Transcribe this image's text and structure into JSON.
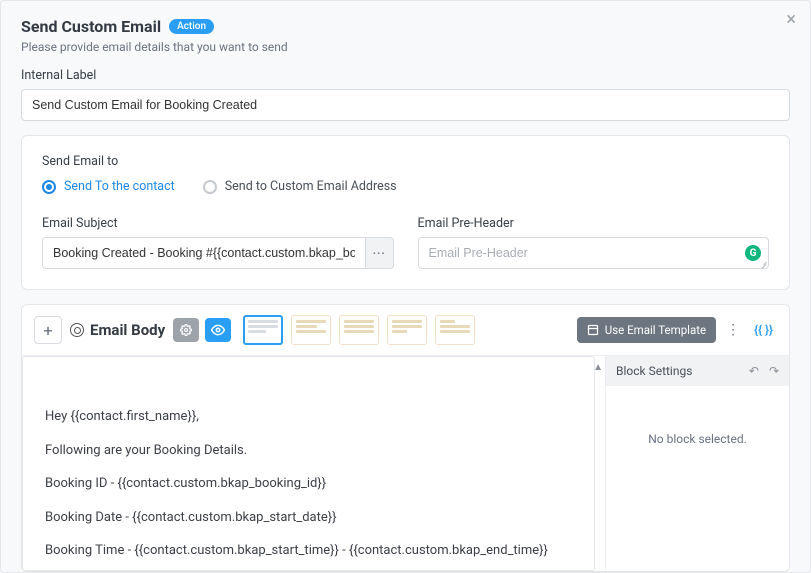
{
  "header": {
    "title": "Send Custom Email",
    "badge": "Action",
    "subtitle": "Please provide email details that you want to send"
  },
  "internalLabel": {
    "label": "Internal Label",
    "value": "Send Custom Email for Booking Created"
  },
  "sendTo": {
    "label": "Send Email to",
    "options": {
      "contact": "Send To the contact",
      "custom": "Send to Custom Email Address"
    },
    "selected": "contact"
  },
  "subject": {
    "label": "Email Subject",
    "value": "Booking Created - Booking #{{contact.custom.bkap_booking_id}"
  },
  "preheader": {
    "label": "Email Pre-Header",
    "placeholder": "Email Pre-Header"
  },
  "editor": {
    "bodyTitle": "Email Body",
    "useTemplate": "Use Email Template",
    "braces": "{{ }}",
    "blockSettings": {
      "title": "Block Settings",
      "empty": "No block selected."
    },
    "content": {
      "line1": "Hey {{contact.first_name}},",
      "line2": "Following are your Booking Details.",
      "line3": "Booking ID - {{contact.custom.bkap_booking_id}}",
      "line4": "Booking Date - {{contact.custom.bkap_start_date}}",
      "line5": "Booking Time - {{contact.custom.bkap_start_time}} - {{contact.custom.bkap_end_time}}"
    }
  }
}
